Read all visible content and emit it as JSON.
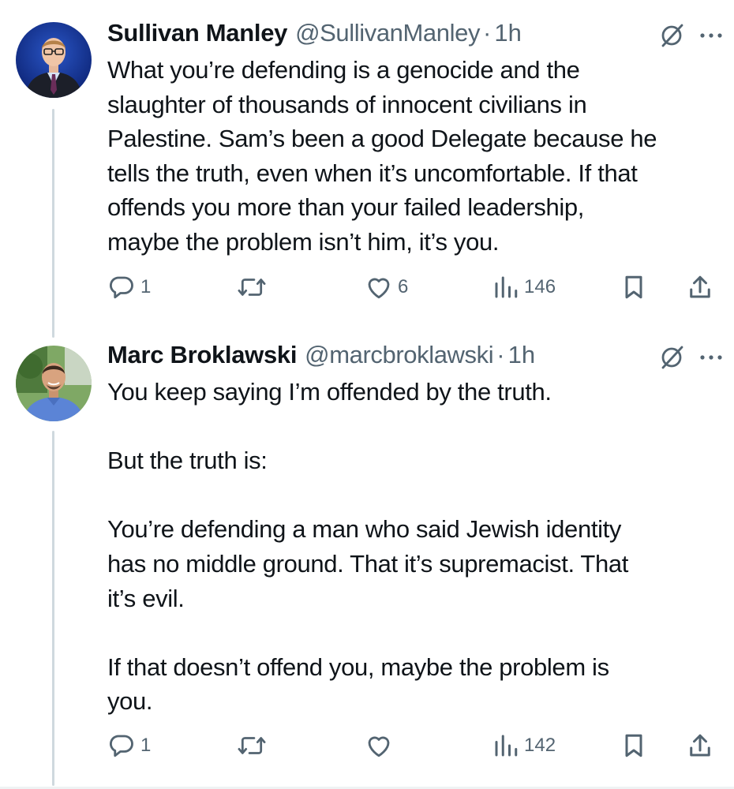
{
  "thread": [
    {
      "author_name": "Sullivan Manley",
      "author_handle": "@SullivanManley",
      "separator": "·",
      "time": "1h",
      "text": "What you’re defending is a genocide and the\nslaughter of thousands of innocent civilians in\nPalestine. Sam’s been a good Delegate because he\ntells the truth, even when it’s uncomfortable. If that\noffends you more than your failed leadership,\nmaybe the problem isn’t him, it’s you.",
      "replies": "1",
      "reposts": "",
      "likes": "6",
      "views": "146"
    },
    {
      "author_name": "Marc Broklawski",
      "author_handle": "@marcbroklawski",
      "separator": "·",
      "time": "1h",
      "text": "You keep saying I’m offended by the truth.\n\nBut the truth is:\n\nYou’re defending a man who said Jewish identity\nhas no middle ground. That it’s supremacist. That\nit’s evil.\n\nIf that doesn’t offend you, maybe the problem is\nyou.",
      "replies": "1",
      "reposts": "",
      "likes": "",
      "views": "142"
    }
  ],
  "icons": {
    "reply": "reply-icon",
    "repost": "repost-icon",
    "like": "heart-icon",
    "views": "views-icon",
    "bookmark": "bookmark-icon",
    "share": "share-icon",
    "mute": "mute-icon",
    "more": "more-icon"
  },
  "colors": {
    "text": "#0f1419",
    "secondary": "#536471",
    "thread_line": "#cfd9de"
  }
}
